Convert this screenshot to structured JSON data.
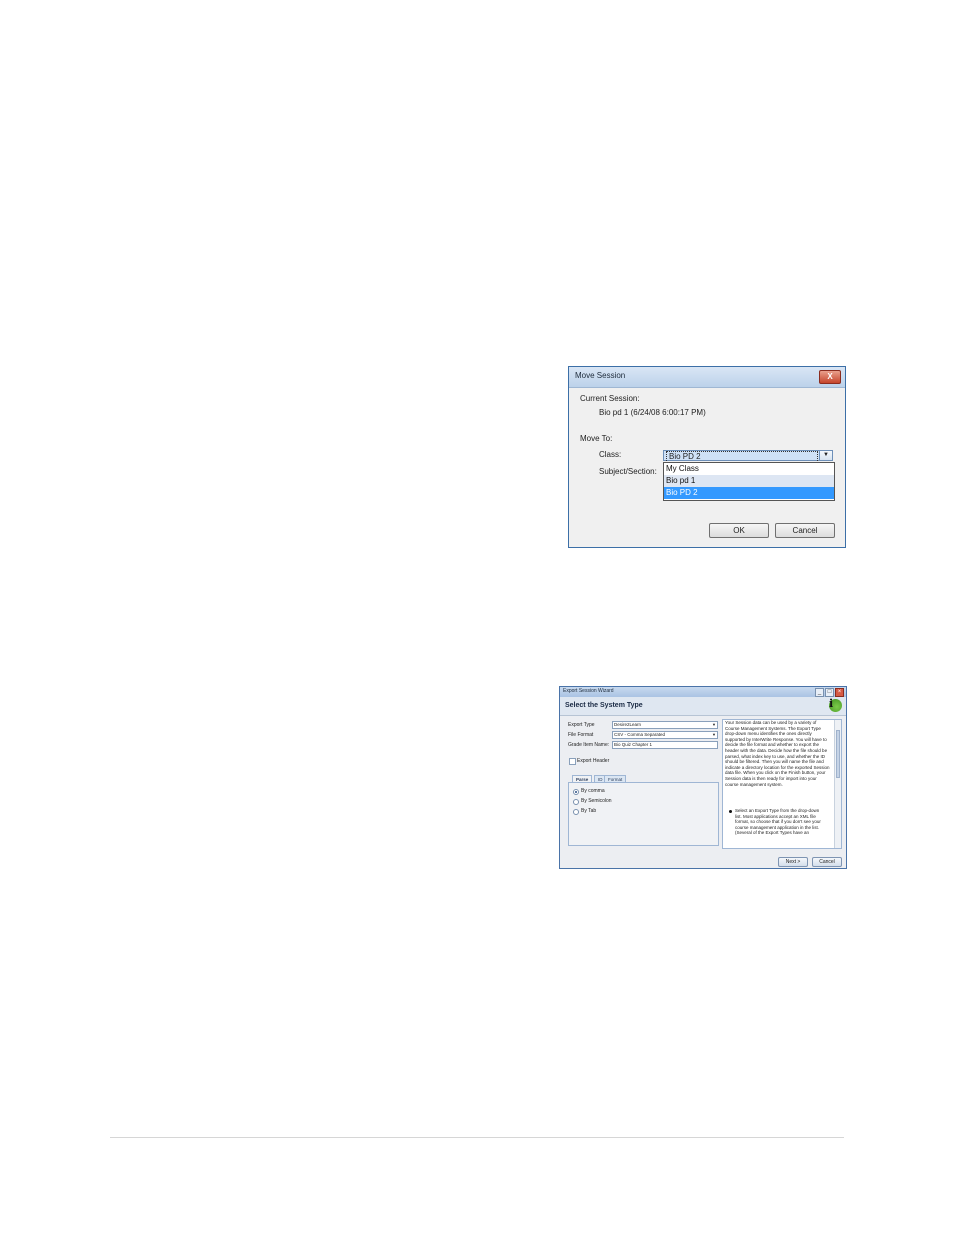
{
  "move_session": {
    "title": "Move Session",
    "close_label": "X",
    "current_session_label": "Current Session:",
    "current_session_value": "Bio pd 1 (6/24/08 6:00:17 PM)",
    "move_to_label": "Move To:",
    "class_label": "Class:",
    "subject_label": "Subject/Section:",
    "class_selected": "Bio PD 2",
    "class_options": [
      "My Class",
      "Bio pd 1",
      "Bio PD 2"
    ],
    "ok_label": "OK",
    "cancel_label": "Cancel"
  },
  "export_wizard": {
    "title": "Export Session Wizard",
    "header_title": "Select the System Type",
    "export_type_label": "Export Type",
    "export_type_value": "Desire2Learn",
    "file_format_label": "File Format",
    "file_format_value": "CSV - Comma Separated",
    "grade_item_label": "Grade Item Name:",
    "grade_item_value": "Bio Quiz Chapter 1",
    "export_header_label": "Export Header",
    "tabs": [
      "Parse",
      "ID",
      "Format"
    ],
    "radio_options": [
      "By comma",
      "By Semicolon",
      "By Tab"
    ],
    "help_text": "Your Session data can be used by a variety of Course Management Systems. The Export Type drop-down menu identifies the ones directly supported by InterWrite Response. You will have to decide the file format and whether to export the header with the data. Decide how the file should be parsed, what index key to use, and whether the ID should be filtered. Then you will name the file and indicate a directory location for the exported Session data file. When you click on the Finish button, your Session data is then ready for import into your course management system.",
    "help_bullet": "Select an Export Type from the drop-down list. Most applications accept an XML file format, so choose that if you don't see your course management application in the list. (Several of the Export Types have an",
    "next_label": "Next >",
    "cancel_label": "Cancel"
  }
}
